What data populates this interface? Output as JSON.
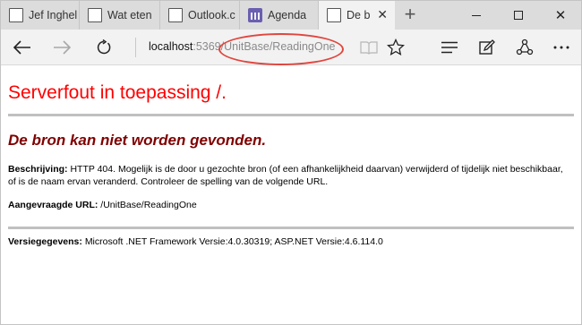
{
  "tabs": [
    {
      "label": "Jef Inghel",
      "icon": "document-icon"
    },
    {
      "label": "Wat eten",
      "icon": "document-icon"
    },
    {
      "label": "Outlook.c",
      "icon": "document-icon"
    },
    {
      "label": "Agenda",
      "icon": "calendar-icon"
    },
    {
      "label": "De b",
      "icon": "document-icon",
      "active": true
    }
  ],
  "address": {
    "host": "localhost",
    "port": ":5369",
    "path": "/UnitBase/ReadingOne"
  },
  "page": {
    "title": "Serverfout in toepassing /.",
    "subtitle": "De bron kan niet worden gevonden.",
    "description_label": "Beschrijving:",
    "description_text": "HTTP 404. Mogelijk is de door u gezochte bron (of een afhankelijkheid daarvan) verwijderd of tijdelijk niet beschikbaar, of is de naam ervan veranderd. Controleer de spelling van de volgende URL.",
    "requested_url_label": "Aangevraagde URL:",
    "requested_url_value": "/UnitBase/ReadingOne",
    "version_label": "Versiegegevens:",
    "version_text": "Microsoft .NET Framework Versie:4.0.30319; ASP.NET Versie:4.6.114.0"
  },
  "colors": {
    "title": "#ff0000",
    "subtitle": "#800000",
    "annotation": "#e0463f"
  }
}
